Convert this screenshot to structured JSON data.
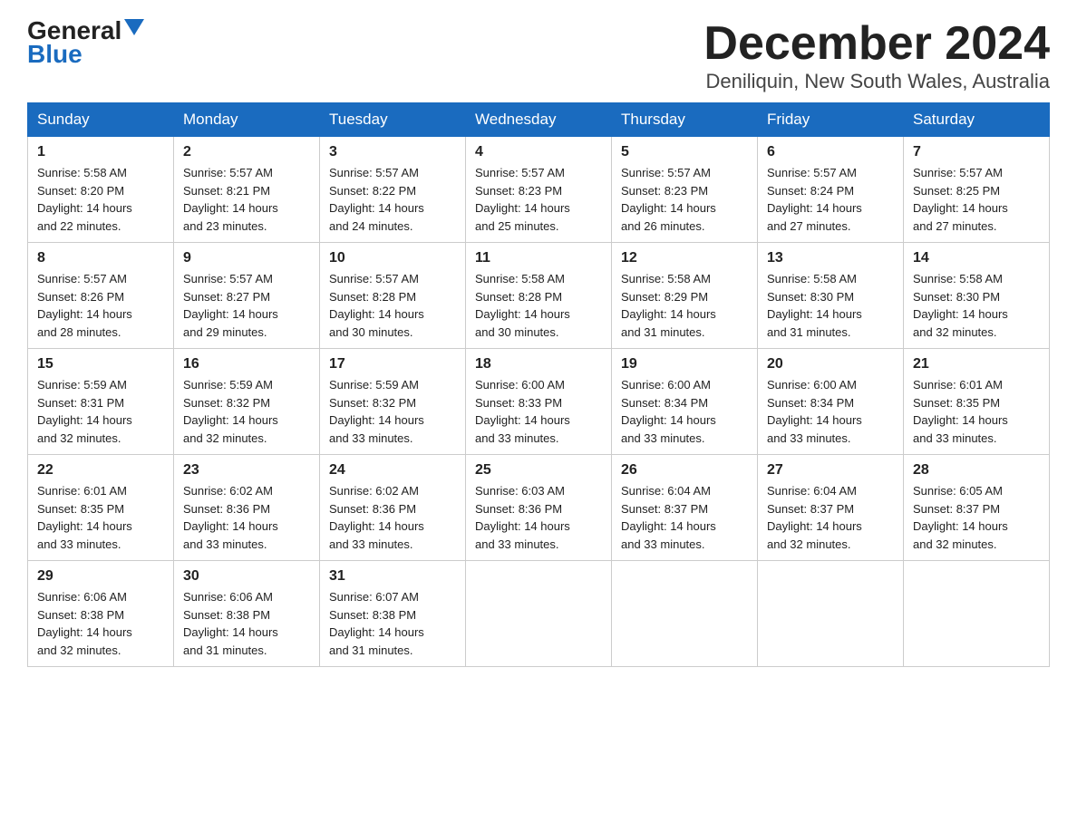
{
  "header": {
    "logo_general": "General",
    "logo_blue": "Blue",
    "month_title": "December 2024",
    "location": "Deniliquin, New South Wales, Australia"
  },
  "days_of_week": [
    "Sunday",
    "Monday",
    "Tuesday",
    "Wednesday",
    "Thursday",
    "Friday",
    "Saturday"
  ],
  "weeks": [
    [
      {
        "num": "1",
        "sunrise": "5:58 AM",
        "sunset": "8:20 PM",
        "daylight": "14 hours and 22 minutes."
      },
      {
        "num": "2",
        "sunrise": "5:57 AM",
        "sunset": "8:21 PM",
        "daylight": "14 hours and 23 minutes."
      },
      {
        "num": "3",
        "sunrise": "5:57 AM",
        "sunset": "8:22 PM",
        "daylight": "14 hours and 24 minutes."
      },
      {
        "num": "4",
        "sunrise": "5:57 AM",
        "sunset": "8:23 PM",
        "daylight": "14 hours and 25 minutes."
      },
      {
        "num": "5",
        "sunrise": "5:57 AM",
        "sunset": "8:23 PM",
        "daylight": "14 hours and 26 minutes."
      },
      {
        "num": "6",
        "sunrise": "5:57 AM",
        "sunset": "8:24 PM",
        "daylight": "14 hours and 27 minutes."
      },
      {
        "num": "7",
        "sunrise": "5:57 AM",
        "sunset": "8:25 PM",
        "daylight": "14 hours and 27 minutes."
      }
    ],
    [
      {
        "num": "8",
        "sunrise": "5:57 AM",
        "sunset": "8:26 PM",
        "daylight": "14 hours and 28 minutes."
      },
      {
        "num": "9",
        "sunrise": "5:57 AM",
        "sunset": "8:27 PM",
        "daylight": "14 hours and 29 minutes."
      },
      {
        "num": "10",
        "sunrise": "5:57 AM",
        "sunset": "8:28 PM",
        "daylight": "14 hours and 30 minutes."
      },
      {
        "num": "11",
        "sunrise": "5:58 AM",
        "sunset": "8:28 PM",
        "daylight": "14 hours and 30 minutes."
      },
      {
        "num": "12",
        "sunrise": "5:58 AM",
        "sunset": "8:29 PM",
        "daylight": "14 hours and 31 minutes."
      },
      {
        "num": "13",
        "sunrise": "5:58 AM",
        "sunset": "8:30 PM",
        "daylight": "14 hours and 31 minutes."
      },
      {
        "num": "14",
        "sunrise": "5:58 AM",
        "sunset": "8:30 PM",
        "daylight": "14 hours and 32 minutes."
      }
    ],
    [
      {
        "num": "15",
        "sunrise": "5:59 AM",
        "sunset": "8:31 PM",
        "daylight": "14 hours and 32 minutes."
      },
      {
        "num": "16",
        "sunrise": "5:59 AM",
        "sunset": "8:32 PM",
        "daylight": "14 hours and 32 minutes."
      },
      {
        "num": "17",
        "sunrise": "5:59 AM",
        "sunset": "8:32 PM",
        "daylight": "14 hours and 33 minutes."
      },
      {
        "num": "18",
        "sunrise": "6:00 AM",
        "sunset": "8:33 PM",
        "daylight": "14 hours and 33 minutes."
      },
      {
        "num": "19",
        "sunrise": "6:00 AM",
        "sunset": "8:34 PM",
        "daylight": "14 hours and 33 minutes."
      },
      {
        "num": "20",
        "sunrise": "6:00 AM",
        "sunset": "8:34 PM",
        "daylight": "14 hours and 33 minutes."
      },
      {
        "num": "21",
        "sunrise": "6:01 AM",
        "sunset": "8:35 PM",
        "daylight": "14 hours and 33 minutes."
      }
    ],
    [
      {
        "num": "22",
        "sunrise": "6:01 AM",
        "sunset": "8:35 PM",
        "daylight": "14 hours and 33 minutes."
      },
      {
        "num": "23",
        "sunrise": "6:02 AM",
        "sunset": "8:36 PM",
        "daylight": "14 hours and 33 minutes."
      },
      {
        "num": "24",
        "sunrise": "6:02 AM",
        "sunset": "8:36 PM",
        "daylight": "14 hours and 33 minutes."
      },
      {
        "num": "25",
        "sunrise": "6:03 AM",
        "sunset": "8:36 PM",
        "daylight": "14 hours and 33 minutes."
      },
      {
        "num": "26",
        "sunrise": "6:04 AM",
        "sunset": "8:37 PM",
        "daylight": "14 hours and 33 minutes."
      },
      {
        "num": "27",
        "sunrise": "6:04 AM",
        "sunset": "8:37 PM",
        "daylight": "14 hours and 32 minutes."
      },
      {
        "num": "28",
        "sunrise": "6:05 AM",
        "sunset": "8:37 PM",
        "daylight": "14 hours and 32 minutes."
      }
    ],
    [
      {
        "num": "29",
        "sunrise": "6:06 AM",
        "sunset": "8:38 PM",
        "daylight": "14 hours and 32 minutes."
      },
      {
        "num": "30",
        "sunrise": "6:06 AM",
        "sunset": "8:38 PM",
        "daylight": "14 hours and 31 minutes."
      },
      {
        "num": "31",
        "sunrise": "6:07 AM",
        "sunset": "8:38 PM",
        "daylight": "14 hours and 31 minutes."
      },
      null,
      null,
      null,
      null
    ]
  ],
  "labels": {
    "sunrise": "Sunrise:",
    "sunset": "Sunset:",
    "daylight": "Daylight:"
  }
}
